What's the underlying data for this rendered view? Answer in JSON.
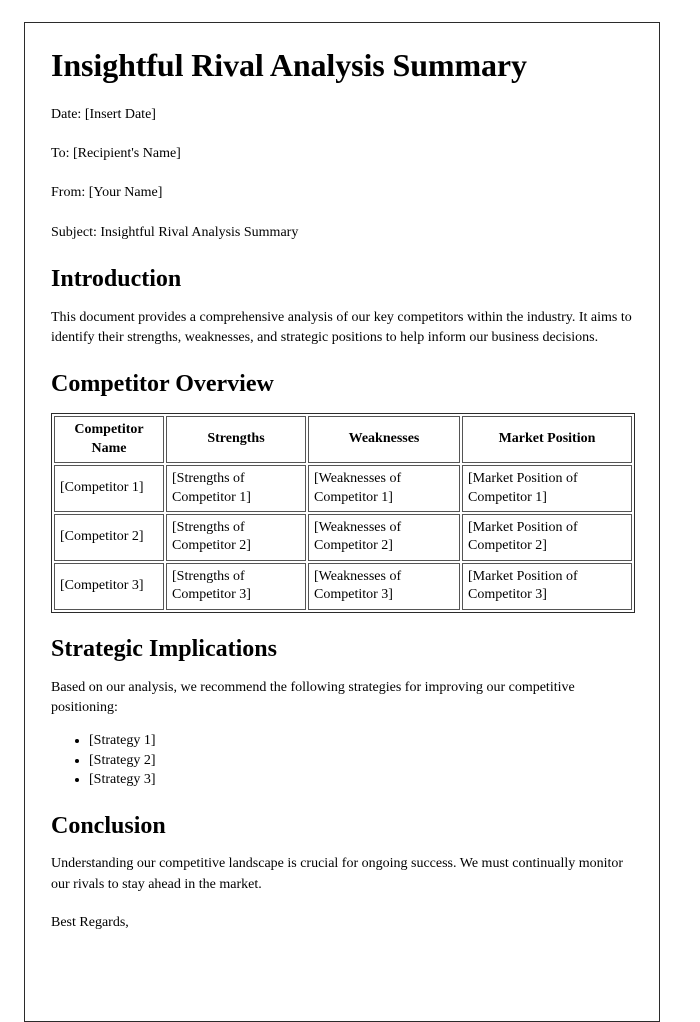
{
  "document": {
    "title": "Insightful Rival Analysis Summary",
    "meta": {
      "date": "Date: [Insert Date]",
      "to": "To: [Recipient's Name]",
      "from": "From: [Your Name]",
      "subject": "Subject: Insightful Rival Analysis Summary"
    },
    "introduction": {
      "heading": "Introduction",
      "paragraph": "This document provides a comprehensive analysis of our key competitors within the industry. It aims to identify their strengths, weaknesses, and strategic positions to help inform our business decisions."
    },
    "competitor_overview": {
      "heading": "Competitor Overview",
      "table": {
        "columns": [
          "Competitor Name",
          "Strengths",
          "Weaknesses",
          "Market Position"
        ],
        "rows": [
          [
            "[Competitor 1]",
            "[Strengths of Competitor 1]",
            "[Weaknesses of Competitor 1]",
            "[Market Position of Competitor 1]"
          ],
          [
            "[Competitor 2]",
            "[Strengths of Competitor 2]",
            "[Weaknesses of Competitor 2]",
            "[Market Position of Competitor 2]"
          ],
          [
            "[Competitor 3]",
            "[Strengths of Competitor 3]",
            "[Weaknesses of Competitor 3]",
            "[Market Position of Competitor 3]"
          ]
        ]
      }
    },
    "strategic_implications": {
      "heading": "Strategic Implications",
      "paragraph": "Based on our analysis, we recommend the following strategies for improving our competitive positioning:",
      "strategies": [
        "[Strategy 1]",
        "[Strategy 2]",
        "[Strategy 3]"
      ]
    },
    "conclusion": {
      "heading": "Conclusion",
      "paragraph": "Understanding our competitive landscape is crucial for ongoing success. We must continually monitor our rivals to stay ahead in the market.",
      "closing": "Best Regards,"
    },
    "colors": {
      "page_border": "#2b2b2b",
      "table_border": "#555555",
      "text": "#000000",
      "background": "#ffffff"
    }
  }
}
